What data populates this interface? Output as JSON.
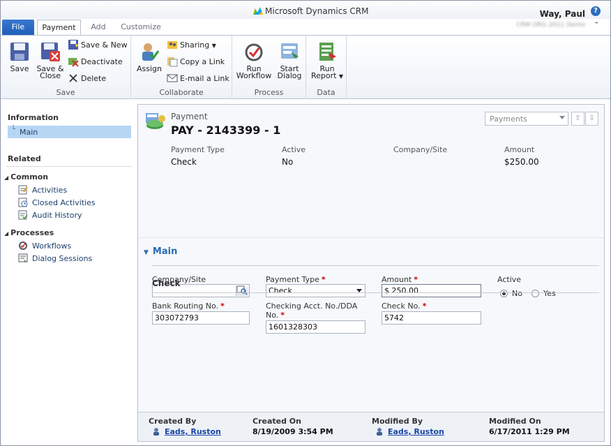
{
  "app": {
    "brand": "Microsoft Dynamics CRM",
    "user_name": "Way, Paul",
    "org_name": "CRM ORG 2011 Demo"
  },
  "tabs": [
    {
      "label": "File"
    },
    {
      "label": "Payment"
    },
    {
      "label": "Add"
    },
    {
      "label": "Customize"
    }
  ],
  "ribbon": {
    "save_group": {
      "label": "Save",
      "save": "Save",
      "save_close": "Save & Close",
      "save_new": "Save & New",
      "deactivate": "Deactivate",
      "delete": "Delete"
    },
    "collaborate_group": {
      "label": "Collaborate",
      "assign": "Assign",
      "sharing": "Sharing",
      "copy_link": "Copy a Link",
      "email_link": "E-mail a Link"
    },
    "process_group": {
      "label": "Process",
      "run_workflow": "Run Workflow",
      "start_dialog": "Start Dialog"
    },
    "data_group": {
      "label": "Data",
      "run_report": "Run Report"
    }
  },
  "nav": {
    "information_header": "Information",
    "main_item": "Main",
    "related_header": "Related",
    "common_header": "Common",
    "common_items": [
      "Activities",
      "Closed Activities",
      "Audit History"
    ],
    "processes_header": "Processes",
    "process_items": [
      "Workflows",
      "Dialog Sessions"
    ]
  },
  "record": {
    "entity_type": "Payment",
    "title": "PAY - 2143399 - 1",
    "view_selector": "Payments"
  },
  "header_fields": [
    {
      "label": "Payment Type",
      "value": "Check"
    },
    {
      "label": "Active",
      "value": "No"
    },
    {
      "label": "Company/Site",
      "value": ""
    },
    {
      "label": "Amount",
      "value": "$250.00"
    }
  ],
  "form": {
    "section_title": "Main",
    "company_site": {
      "label": "Company/Site",
      "value": ""
    },
    "payment_type": {
      "label": "Payment Type",
      "value": "Check",
      "required": "*"
    },
    "amount": {
      "label": "Amount",
      "value": "$ 250.00",
      "required": "*"
    },
    "active": {
      "label": "Active",
      "options": [
        "No",
        "Yes"
      ],
      "selected": "No"
    },
    "check_section": "Check",
    "bank_routing": {
      "label": "Bank Routing No.",
      "value": "303072793",
      "required": "*"
    },
    "checking_acct": {
      "label": "Checking Acct. No./DDA No.",
      "value": "1601328303",
      "required": "*"
    },
    "check_no": {
      "label": "Check No.",
      "value": "5742",
      "required": "*"
    }
  },
  "footer": {
    "created_by_label": "Created By",
    "created_by": "Eads, Ruston",
    "created_on_label": "Created On",
    "created_on": "8/19/2009 3:54 PM",
    "modified_by_label": "Modified By",
    "modified_by": "Eads, Ruston",
    "modified_on_label": "Modified On",
    "modified_on": "6/17/2011 1:29 PM"
  },
  "colors": {
    "accent": "#2b6ab3",
    "file_tab": "#2a69c4",
    "nav_selected": "#b7d6f4",
    "required": "#cc0000"
  }
}
